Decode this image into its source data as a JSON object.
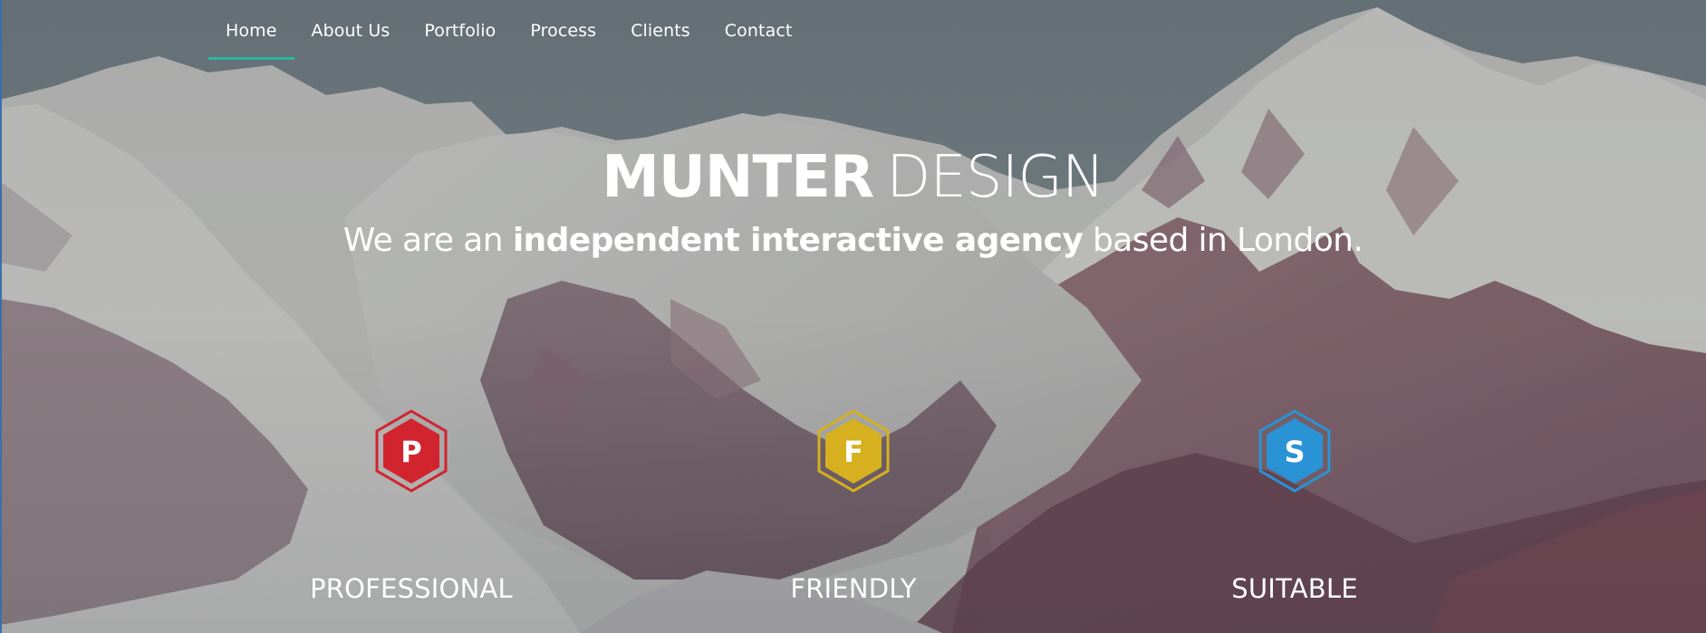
{
  "nav": {
    "items": [
      {
        "label": "Home",
        "active": true
      },
      {
        "label": "About Us",
        "active": false
      },
      {
        "label": "Portfolio",
        "active": false
      },
      {
        "label": "Process",
        "active": false
      },
      {
        "label": "Clients",
        "active": false
      },
      {
        "label": "Contact",
        "active": false
      }
    ],
    "active_color": "#29b89c"
  },
  "hero": {
    "title_strong": "MUNTER",
    "title_light": "DESIGN",
    "tagline_before": "We are an ",
    "tagline_strong": "independent interactive agency",
    "tagline_after": " based in London."
  },
  "features": [
    {
      "letter": "P",
      "label": "PROFESSIONAL",
      "color": "#d1242f",
      "icon": "hexagon-p-icon"
    },
    {
      "letter": "F",
      "label": "FRIENDLY",
      "color": "#d6b01e",
      "icon": "hexagon-f-icon"
    },
    {
      "letter": "S",
      "label": "SUITABLE",
      "color": "#2a93d5",
      "icon": "hexagon-s-icon"
    }
  ]
}
